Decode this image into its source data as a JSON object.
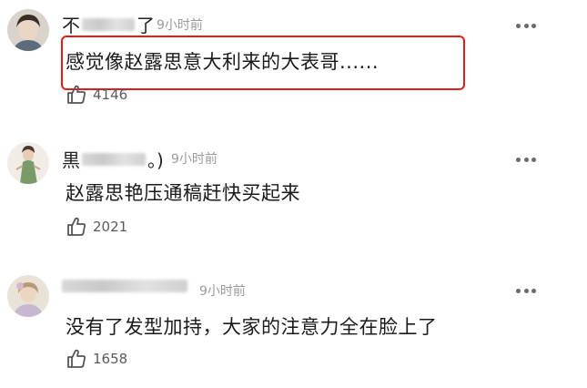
{
  "comments": [
    {
      "username_prefix": "不",
      "username_suffix": "了",
      "time": "9小时前",
      "text": "感觉像赵露思意大利来的大表哥......",
      "likes": "4146",
      "highlighted": true
    },
    {
      "username_prefix": "黒",
      "username_suffix": "。)",
      "time": "9小时前",
      "text": "赵露思艳压通稿赶快买起来",
      "likes": "2021"
    },
    {
      "username_prefix": "",
      "username_suffix": "",
      "time": "9小时前",
      "text": "没有了发型加持，大家的注意力全在脸上了",
      "likes": "1658"
    }
  ],
  "colors": {
    "highlight_border": "#e31b1b",
    "time_text": "#9b9b9b",
    "more_dots": "#6a6a6a"
  },
  "icons": {
    "more": "more-horizontal-icon",
    "like": "thumbs-up-icon"
  }
}
